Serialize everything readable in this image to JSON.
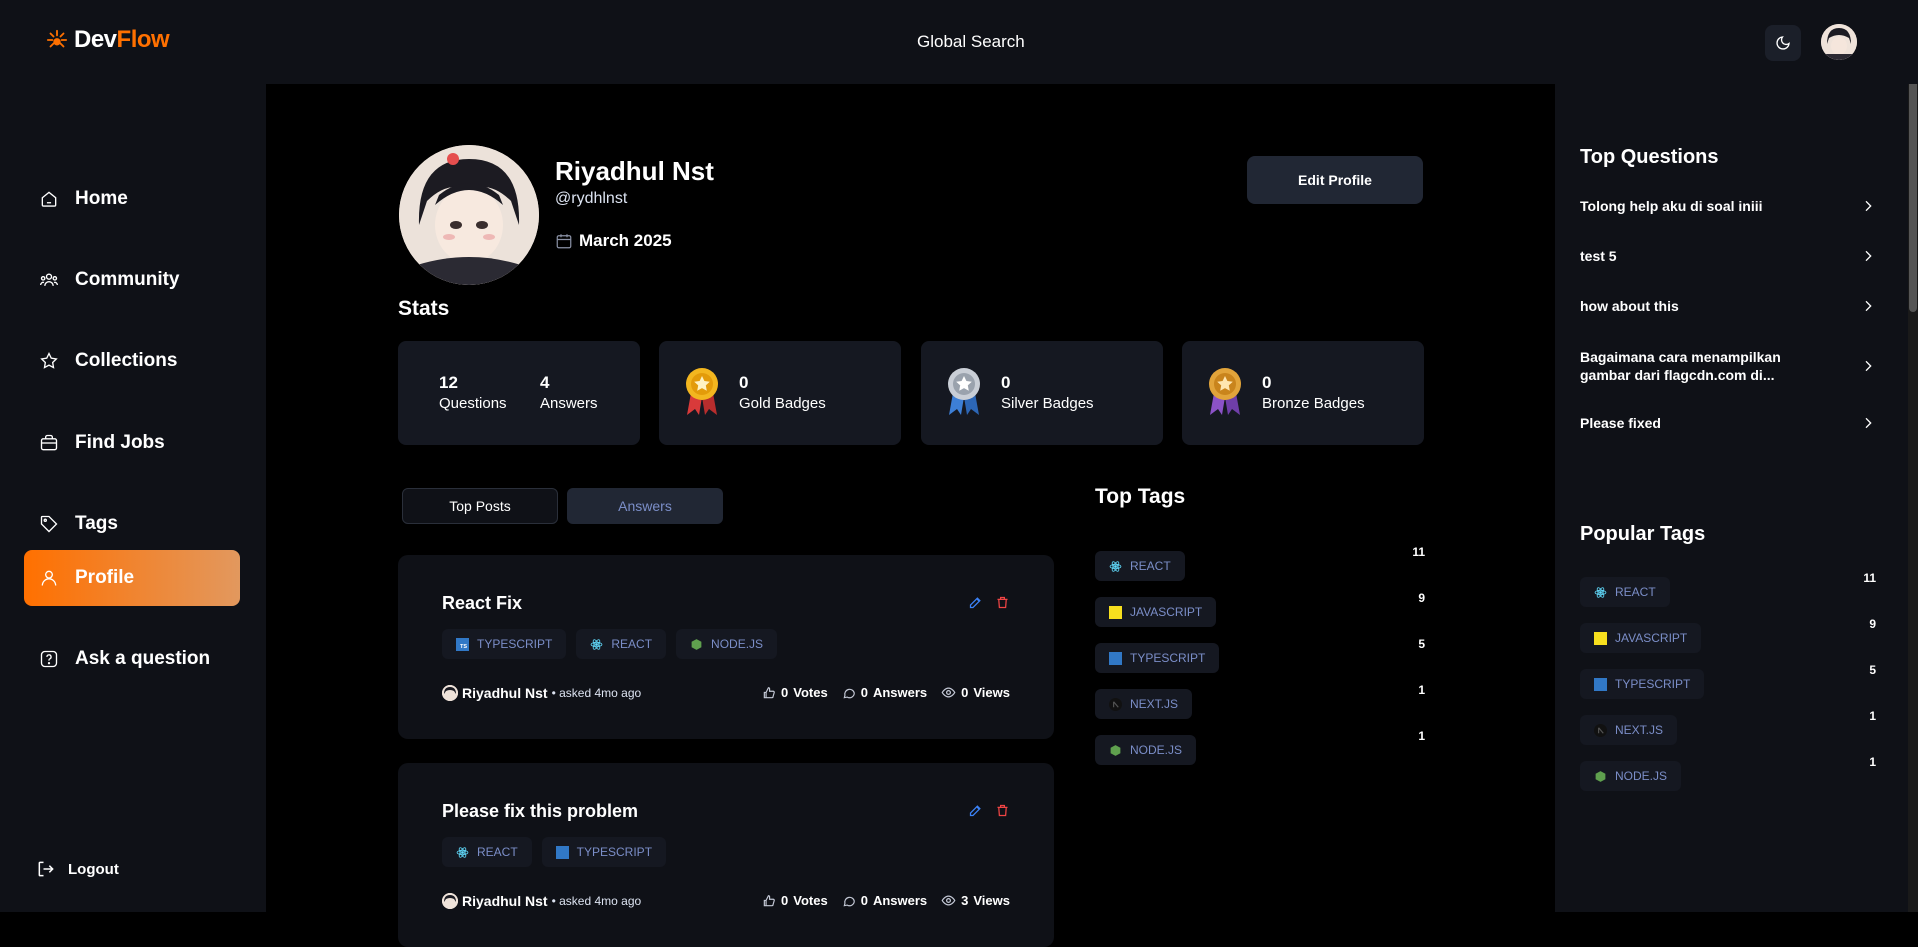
{
  "brand": {
    "part1": "Dev",
    "part2": "Flow"
  },
  "header": {
    "search_label": "Global Search"
  },
  "sidebar": {
    "items": [
      {
        "label": "Home",
        "icon": "home-icon"
      },
      {
        "label": "Community",
        "icon": "users-icon"
      },
      {
        "label": "Collections",
        "icon": "star-icon"
      },
      {
        "label": "Find Jobs",
        "icon": "briefcase-icon"
      },
      {
        "label": "Tags",
        "icon": "tag-icon"
      },
      {
        "label": "Profile",
        "icon": "user-icon",
        "active": true
      },
      {
        "label": "Ask a question",
        "icon": "question-icon"
      }
    ],
    "logout": "Logout"
  },
  "profile": {
    "name": "Riyadhul Nst",
    "username": "@rydhlnst",
    "joined": "March 2025",
    "edit_label": "Edit Profile"
  },
  "stats": {
    "title": "Stats",
    "questions": {
      "value": "12",
      "label": "Questions"
    },
    "answers": {
      "value": "4",
      "label": "Answers"
    },
    "gold": {
      "value": "0",
      "label": "Gold Badges"
    },
    "silver": {
      "value": "0",
      "label": "Silver Badges"
    },
    "bronze": {
      "value": "0",
      "label": "Bronze Badges"
    }
  },
  "tabs": [
    {
      "label": "Top Posts"
    },
    {
      "label": "Answers"
    }
  ],
  "posts": [
    {
      "title": "React Fix",
      "tags": [
        "typescript",
        "react",
        "node.js"
      ],
      "author": "Riyadhul Nst",
      "time": "• asked 4mo ago",
      "votes": "0",
      "votes_label": "Votes",
      "answers": "0",
      "answers_label": "Answers",
      "views": "0",
      "views_label": "Views"
    },
    {
      "title": "Please fix this problem",
      "tags": [
        "react",
        "typescript"
      ],
      "author": "Riyadhul Nst",
      "time": "• asked 4mo ago",
      "votes": "0",
      "votes_label": "Votes",
      "answers": "0",
      "answers_label": "Answers",
      "views": "3",
      "views_label": "Views"
    }
  ],
  "top_tags": {
    "title": "Top Tags",
    "items": [
      {
        "name": "react",
        "count": "11"
      },
      {
        "name": "javascript",
        "count": "9"
      },
      {
        "name": "typescript",
        "count": "5"
      },
      {
        "name": "next.js",
        "count": "1"
      },
      {
        "name": "node.js",
        "count": "1"
      }
    ]
  },
  "right": {
    "questions_title": "Top Questions",
    "questions": [
      "Tolong help aku di soal iniii",
      "test 5",
      "how about this",
      "Bagaimana cara menampilkan gambar dari flagcdn.com di...",
      "Please fixed"
    ],
    "tags_title": "Popular Tags",
    "tags": [
      {
        "name": "react",
        "count": "11"
      },
      {
        "name": "javascript",
        "count": "9"
      },
      {
        "name": "typescript",
        "count": "5"
      },
      {
        "name": "next.js",
        "count": "1"
      },
      {
        "name": "node.js",
        "count": "1"
      }
    ]
  },
  "colors": {
    "accent": "#ff7000",
    "tag_text": "#7b8ec8",
    "card_bg": "#151821"
  }
}
